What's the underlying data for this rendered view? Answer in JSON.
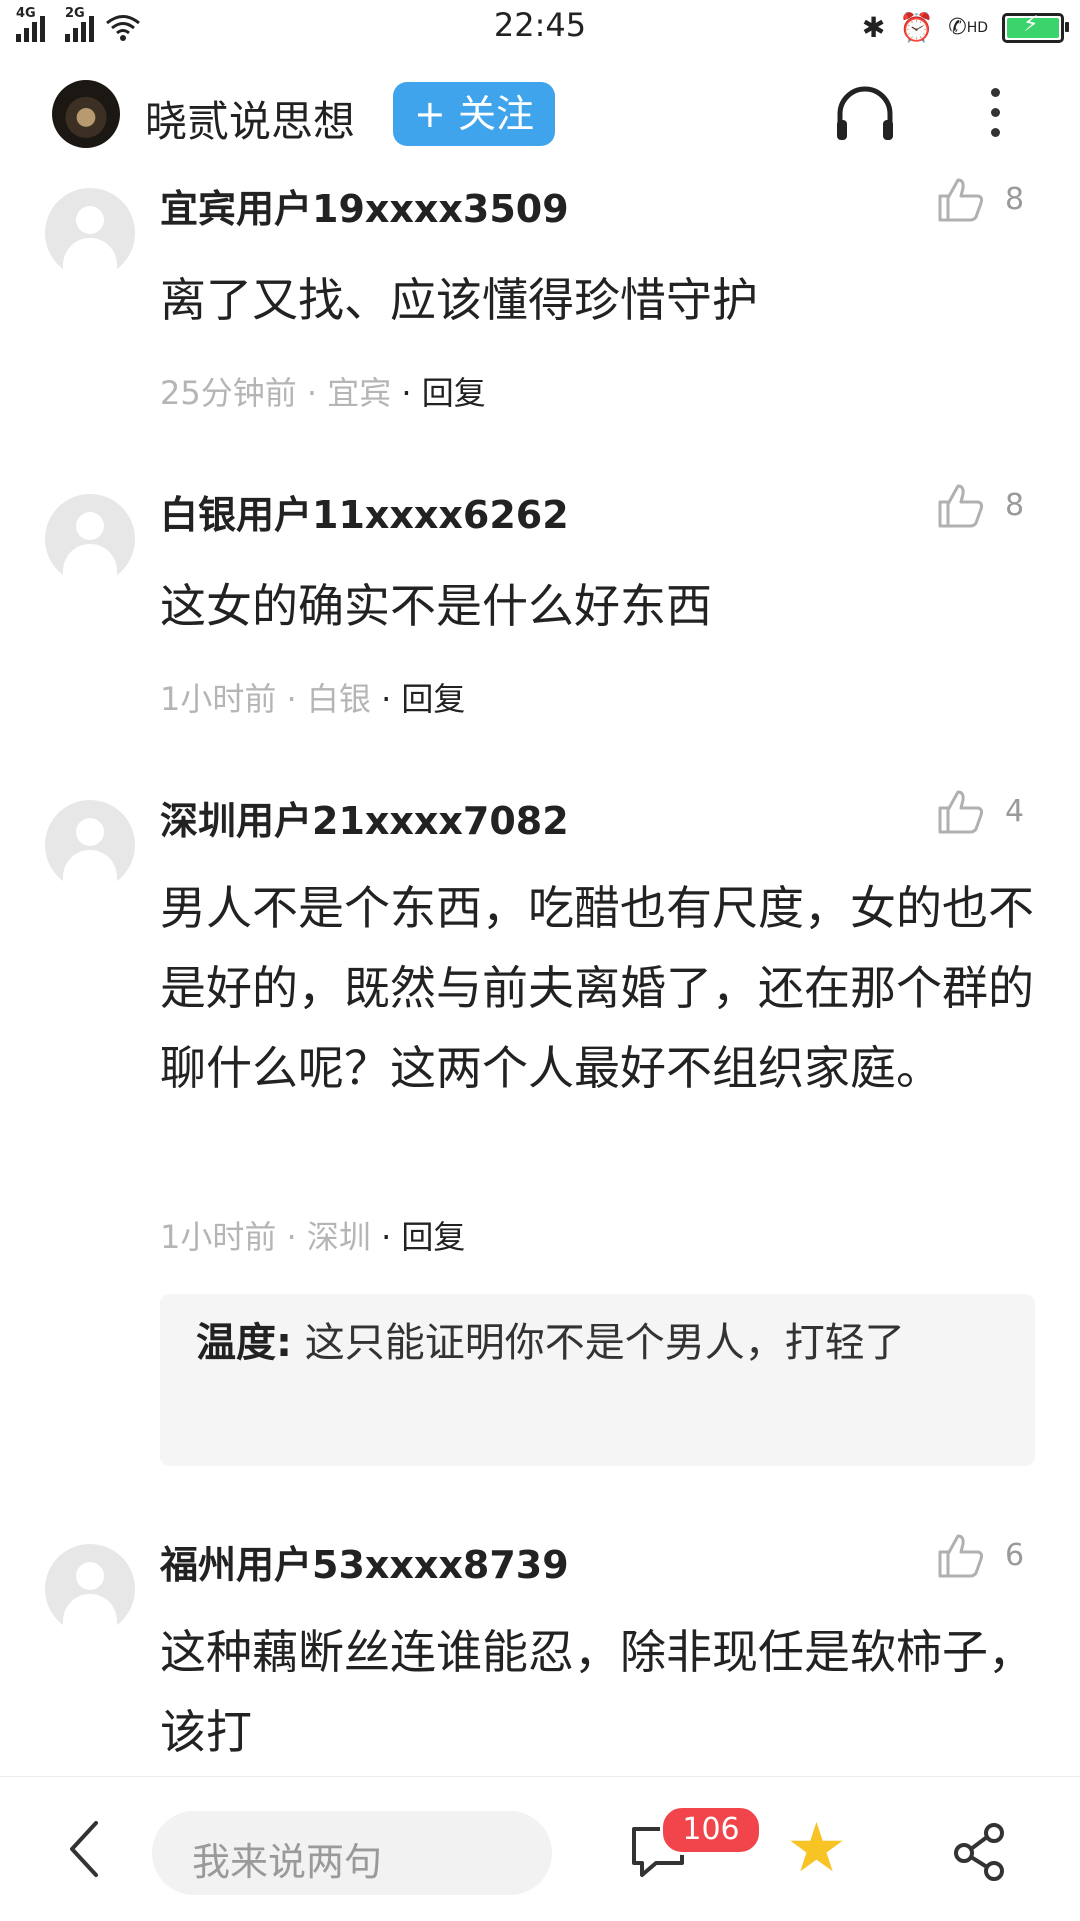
{
  "status_bar": {
    "signal1": "4G",
    "signal2": "2G",
    "time": "22:45",
    "network": "HD"
  },
  "header": {
    "channel_name": "晓贰说思想",
    "follow_label": "+ 关注"
  },
  "comments": [
    {
      "name": "宜宾用户19xxxx3509",
      "likes": "8",
      "text": "离了又找、应该懂得珍惜守护",
      "meta": "25分钟前 · 宜宾",
      "reply": "· 回复"
    },
    {
      "name": "白银用户11xxxx6262",
      "likes": "8",
      "text": "这女的确实不是什么好东西",
      "meta": "1小时前 · 白银",
      "reply": "· 回复"
    },
    {
      "name": "深圳用户21xxxx7082",
      "likes": "4",
      "text": "男人不是个东西，吃醋也有尺度，女的也不是好的，既然与前夫离婚了，还在那个群的聊什么呢？这两个人最好不组织家庭。",
      "meta": "1小时前 · 深圳",
      "reply": "· 回复",
      "sub_reply": {
        "name": "温度:",
        "text": "这只能证明你不是个男人，打轻了"
      }
    },
    {
      "name": "福州用户53xxxx8739",
      "likes": "6",
      "text": "这种藕断丝连谁能忍，除非现任是软柿子，该打"
    }
  ],
  "bottom_bar": {
    "input_placeholder": "我来说两句",
    "comment_count": "106"
  },
  "colors": {
    "follow_button": "#3fa4ec",
    "badge": "#f2454b",
    "star": "#f7c325"
  }
}
